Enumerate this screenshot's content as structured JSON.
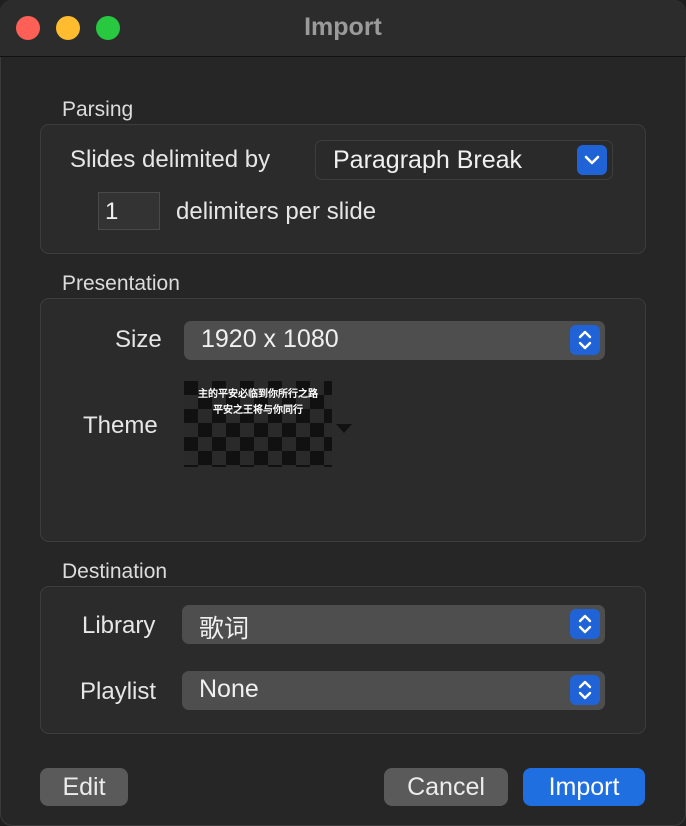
{
  "window": {
    "title": "Import"
  },
  "parsing": {
    "label": "Parsing",
    "slides_delimited_label": "Slides delimited by",
    "delimiter_value": "Paragraph Break",
    "delimiters_count": "1",
    "delimiters_suffix": "delimiters per slide"
  },
  "presentation": {
    "label": "Presentation",
    "size_label": "Size",
    "size_value": "1920 x 1080",
    "theme_label": "Theme",
    "theme_preview_line1": "主的平安必临到你所行之路",
    "theme_preview_line2": "平安之王将与你同行"
  },
  "destination": {
    "label": "Destination",
    "library_label": "Library",
    "library_value": "歌词",
    "playlist_label": "Playlist",
    "playlist_value": "None"
  },
  "buttons": {
    "edit": "Edit",
    "cancel": "Cancel",
    "import": "Import"
  },
  "colors": {
    "accent": "#1f6fe0",
    "window_bg": "#262626",
    "close": "#fe5f57",
    "minimize": "#febc2e",
    "zoom": "#28c840"
  }
}
